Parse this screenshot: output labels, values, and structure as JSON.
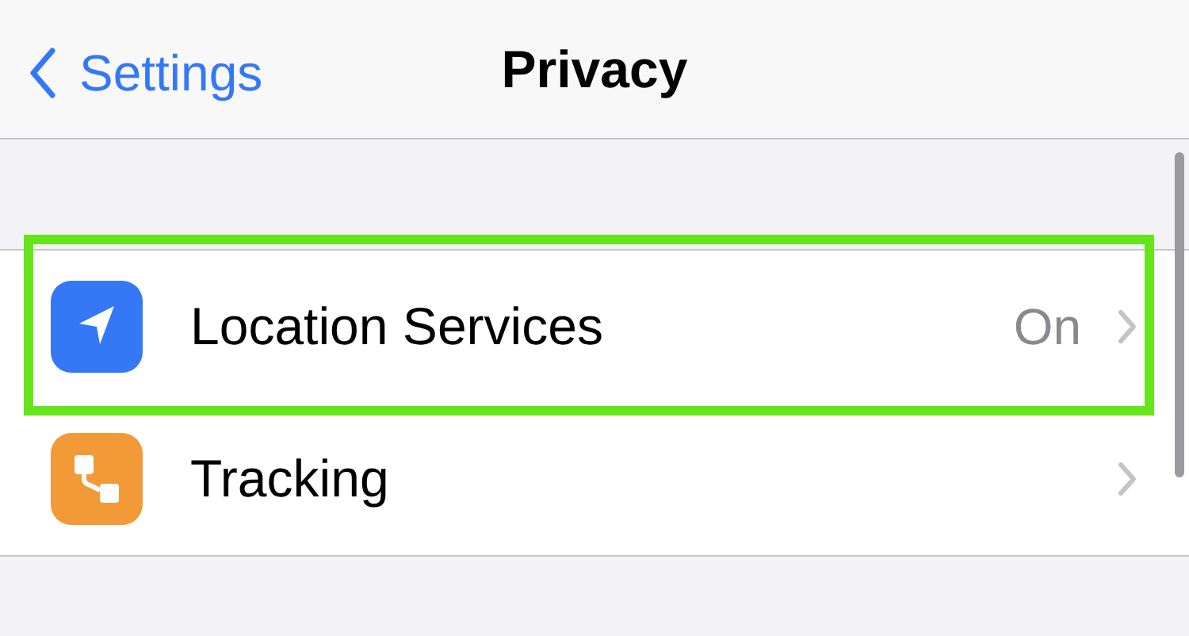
{
  "nav_bar": {
    "back_label": "Settings",
    "title": "Privacy"
  },
  "rows": [
    {
      "kind": "location",
      "label": "Location Services",
      "value": "On",
      "highlighted": true
    },
    {
      "kind": "tracking",
      "label": "Tracking",
      "highlighted": false
    }
  ]
}
